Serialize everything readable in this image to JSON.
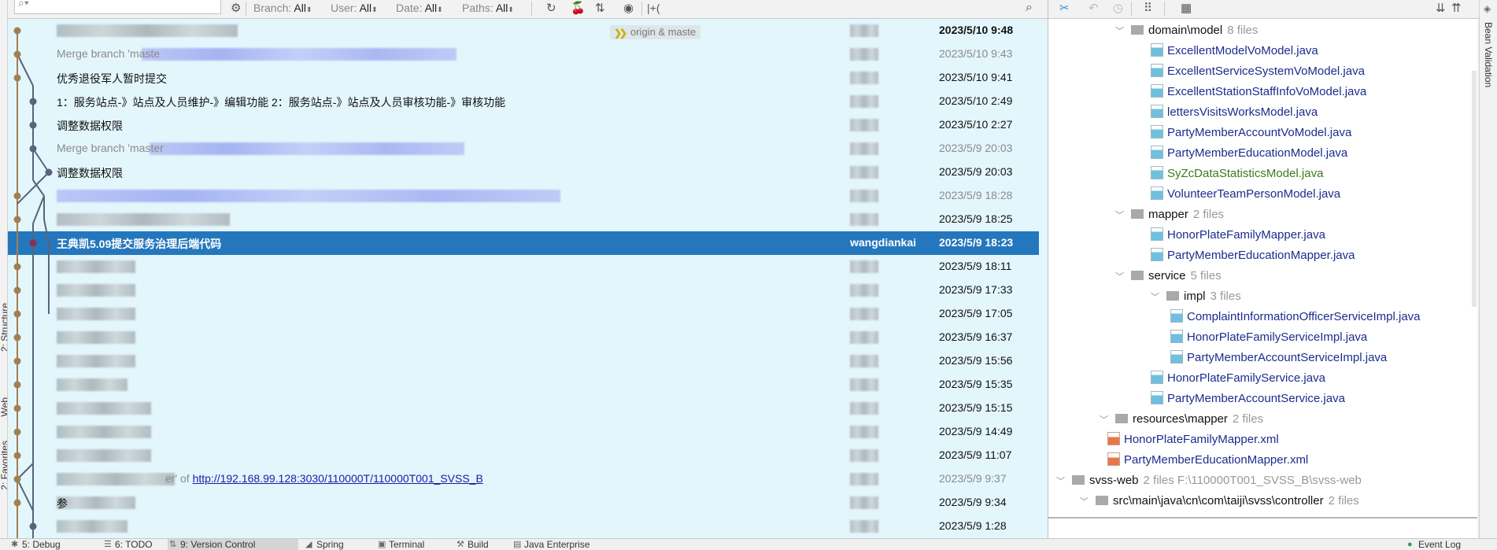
{
  "left_stripe": {
    "items": [
      {
        "label": "2: Structure"
      },
      {
        "label": "Web"
      },
      {
        "label": "2: Favorites"
      }
    ]
  },
  "toolbar": {
    "search_icon": "search-icon",
    "search_placeholder": "",
    "filters": [
      {
        "name": "Branch:",
        "value": "All"
      },
      {
        "name": "User:",
        "value": "All"
      },
      {
        "name": "Date:",
        "value": "All"
      },
      {
        "name": "Paths:",
        "value": "All"
      }
    ],
    "extra_label": "|+("
  },
  "log": {
    "head_tag": "origin & maste",
    "rows": [
      {
        "message": "",
        "author": "",
        "date": "2023/5/10 9:48",
        "date_style": "bold"
      },
      {
        "message": "Merge branch 'maste",
        "muted": true,
        "author": "",
        "date": "2023/5/10 9:43",
        "date_style": "muted"
      },
      {
        "message": "优秀退役军人暂时提交",
        "author": "",
        "date": "2023/5/10 9:41"
      },
      {
        "message": "1：服务站点-》站点及人员维护-》编辑功能 2：服务站点-》站点及人员审核功能-》审核功能",
        "author": "",
        "date": "2023/5/10 2:49"
      },
      {
        "message": "调整数据权限",
        "author": "",
        "date": "2023/5/10 2:27"
      },
      {
        "message": "Merge branch 'master",
        "muted": true,
        "author": "",
        "date": "2023/5/9 20:03",
        "date_style": "muted"
      },
      {
        "message": "调整数据权限",
        "author": "",
        "date": "2023/5/9 20:03"
      },
      {
        "message": "",
        "author": "",
        "date": "2023/5/9 18:28",
        "date_style": "muted"
      },
      {
        "message": "",
        "author": "",
        "date": "2023/5/9 18:25"
      },
      {
        "message": "王典凯5.09提交服务治理后端代码",
        "author": "wangdiankai",
        "date": "2023/5/9 18:23",
        "selected": true
      },
      {
        "message": "",
        "author": "",
        "date": "2023/5/9 18:11"
      },
      {
        "message": "",
        "author": "",
        "date": "2023/5/9 17:33"
      },
      {
        "message": "",
        "author": "",
        "date": "2023/5/9 17:05"
      },
      {
        "message": "",
        "author": "",
        "date": "2023/5/9 16:37"
      },
      {
        "message": "",
        "author": "",
        "date": "2023/5/9 15:56"
      },
      {
        "message": "",
        "author": "",
        "date": "2023/5/9 15:35"
      },
      {
        "message": "",
        "author": "",
        "date": "2023/5/9 15:15"
      },
      {
        "message": "",
        "author": "",
        "date": "2023/5/9 14:49"
      },
      {
        "message": "",
        "author": "",
        "date": "2023/5/9 11:07"
      },
      {
        "message": "er' of ",
        "muted": true,
        "link": "http://192.168.99.128:3030/110000T/110000T001_SVSS_B",
        "author": "",
        "date": "2023/5/9 9:37",
        "date_style": "muted"
      },
      {
        "message": "参",
        "author": "",
        "date": "2023/5/9 9:34"
      },
      {
        "message": "",
        "author": "",
        "date": "2023/5/9 1:28"
      }
    ]
  },
  "right_toolbar": {
    "icons": [
      "cherry-pick-icon",
      "revert-icon",
      "history-icon",
      "group-by-icon",
      "layout-icon",
      "expand-all-icon",
      "collapse-all-icon"
    ]
  },
  "tree": {
    "nodes": [
      {
        "type": "folder",
        "label": "domain\\model",
        "count": "8 files"
      },
      {
        "type": "java",
        "label": "ExcellentModelVoModel.java"
      },
      {
        "type": "java",
        "label": "ExcellentServiceSystemVoModel.java"
      },
      {
        "type": "java",
        "label": "ExcellentStationStaffInfoVoModel.java"
      },
      {
        "type": "java",
        "label": "lettersVisitsWorksModel.java"
      },
      {
        "type": "java",
        "label": "PartyMemberAccountVoModel.java"
      },
      {
        "type": "java",
        "label": "PartyMemberEducationModel.java"
      },
      {
        "type": "java",
        "label": "SyZcDataStatisticsModel.java",
        "status": "added"
      },
      {
        "type": "java",
        "label": "VolunteerTeamPersonModel.java"
      },
      {
        "type": "folder",
        "label": "mapper",
        "count": "2 files"
      },
      {
        "type": "java",
        "label": "HonorPlateFamilyMapper.java"
      },
      {
        "type": "java",
        "label": "PartyMemberEducationMapper.java"
      },
      {
        "type": "folder",
        "label": "service",
        "count": "5 files"
      },
      {
        "type": "folder",
        "label": "impl",
        "count": "3 files"
      },
      {
        "type": "java",
        "label": "ComplaintInformationOfficerServiceImpl.java"
      },
      {
        "type": "java",
        "label": "HonorPlateFamilyServiceImpl.java"
      },
      {
        "type": "java",
        "label": "PartyMemberAccountServiceImpl.java"
      },
      {
        "type": "java",
        "label": "HonorPlateFamilyService.java"
      },
      {
        "type": "java",
        "label": "PartyMemberAccountService.java"
      },
      {
        "type": "folder",
        "label": "resources\\mapper",
        "count": "2 files"
      },
      {
        "type": "xml",
        "label": "HonorPlateFamilyMapper.xml"
      },
      {
        "type": "xml",
        "label": "PartyMemberEducationMapper.xml"
      },
      {
        "type": "module",
        "label": "svss-web",
        "count": "2 files  F:\\110000T001_SVSS_B\\svss-web"
      },
      {
        "type": "folder",
        "label": "src\\main\\java\\cn\\com\\taiji\\svss\\controller",
        "count": "2 files"
      }
    ]
  },
  "bean_strip": {
    "label": "Bean Validation"
  },
  "bottom_bar": {
    "tabs": [
      {
        "label": "5: Debug"
      },
      {
        "label": "6: TODO"
      },
      {
        "label": "9: Version Control",
        "active": true
      },
      {
        "label": "Spring"
      },
      {
        "label": "Terminal"
      },
      {
        "label": "Build"
      },
      {
        "label": "Java Enterprise"
      }
    ],
    "event_log": "Event Log"
  },
  "colors": {
    "log_bg": "#e3f6fc",
    "selected": "#2476bd",
    "lane_main": "#a08050",
    "lane_side": "#5a6478",
    "link": "#1a1aa6",
    "added_file": "#3b7a1f",
    "file_name": "#1c2c8c"
  }
}
